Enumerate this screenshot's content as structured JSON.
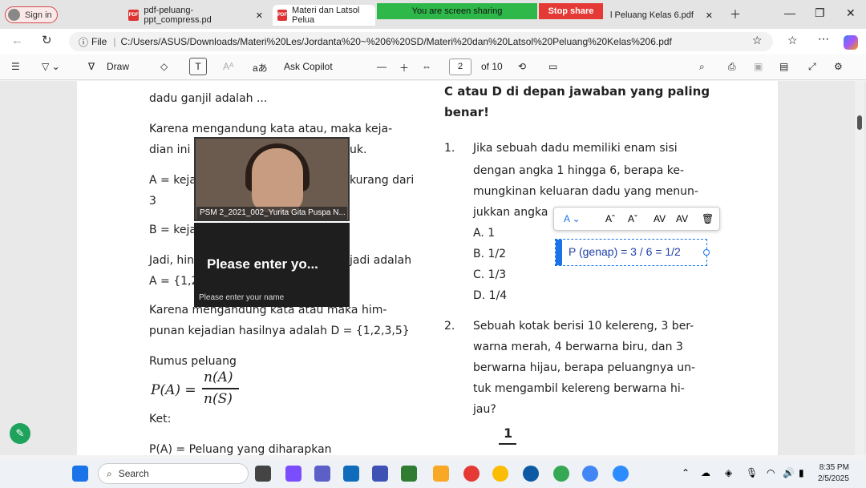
{
  "browser": {
    "signin": "Sign in",
    "tabs": [
      "pdf-peluang-ppt_compress.pd",
      "Materi dan Latsol Pelua",
      "l Peluang Kelas 6.pdf"
    ],
    "share_banner": "You are screen sharing",
    "stop_share": "Stop share",
    "url_prefix": "File",
    "url": "C:/Users/ASUS/Downloads/Materi%20Les/Jordanta%20~%206%20SD/Materi%20dan%20Latsol%20Peluang%20Kelas%206.pdf"
  },
  "pdf_toolbar": {
    "draw": "Draw",
    "ask_copilot": "Ask Copilot",
    "page": "2",
    "of_pages": "of 10"
  },
  "left_col": {
    "l1": "dadu ganjil adalah ...",
    "l2": "Karena mengandung kata atau, maka keja-",
    "l3a": "dian ini",
    "l3b": "uk.",
    "l4a": "A = keja",
    "l4b": "kurang dari",
    "l5": "3",
    "l6": "B = keja",
    "l7a": "Jadi, hin",
    "l7b": "jadi adalah",
    "l8": "A = {1,2",
    "l9": "Karena mengandung kata atau maka him-",
    "l10": "punan kejadian hasilnya adalah D = {1,2,3,5}",
    "l11": "Rumus peluang",
    "formula_lhs": "P(A) =",
    "formula_num": "n(A)",
    "formula_den": "n(S)",
    "ket": "Ket:",
    "l12": "P(A) = Peluang yang diharapkan"
  },
  "right_col": {
    "h1": "C atau D di depan jawaban yang paling",
    "h2": "benar!",
    "q1_num": "1.",
    "q1_l1": "Jika sebuah dadu memiliki enam sisi",
    "q1_l2": "dengan angka 1 hingga 6, berapa ke-",
    "q1_l3": "mungkinan keluaran dadu yang menun-",
    "q1_l4": "jukkan angka",
    "optA": "A.   1",
    "optB": "B.   1/2",
    "optC": "C.   1/3",
    "optD": "D.   1/4",
    "q2_num": "2.",
    "q2_l1": "Sebuah kotak berisi 10 kelereng, 3 ber-",
    "q2_l2": "warna merah, 4 berwarna biru, dan 3",
    "q2_l3": "berwarna hijau, berapa peluangnya un-",
    "q2_l4": "tuk mengambil kelereng berwarna hi-",
    "q2_l5": "jau?",
    "frac_num": "1"
  },
  "overlays": {
    "participant": "PSM 2_2021_002_Yurita Gita Puspa N...",
    "prompt_title": "Please enter yo...",
    "prompt_sub": "Please enter your name",
    "textbox": "P (genap) = 3 / 6 = 1/2"
  },
  "taskbar": {
    "search": "Search",
    "time": "8:35 PM",
    "date": "2/5/2025"
  }
}
